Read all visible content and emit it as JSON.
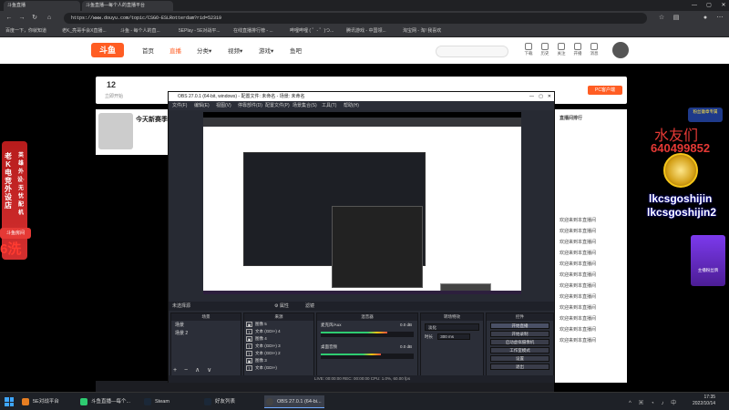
{
  "browser": {
    "tabs": [
      {
        "label": "斗鱼直播"
      },
      {
        "label": "斗鱼直播—每个人的直播平台"
      }
    ],
    "url": "https://www.douyu.com/topic/CSGO-ESLRotterdam?rid=52319",
    "bookmarks": [
      "百度一下，你就知道",
      "老K_亮哥手会X直播...",
      "斗鱼 - 每个人的直...",
      "5EPlay - 5E对战平...",
      "在线直播排行榜 - ...",
      "哔哩哔哩 ( ゜- ゜)つ...",
      "腾讯游戏 - 中国领...",
      "淘宝网 - 淘! 我喜欢"
    ]
  },
  "douyu": {
    "logo": "斗鱼",
    "nav": [
      "首页",
      "直播",
      "分类▾",
      "视频▾",
      "游戏▾",
      "鱼吧"
    ],
    "top_icons": [
      "下载",
      "历史",
      "关注",
      "开播",
      "消息"
    ],
    "top_panel": {
      "count": "12",
      "count_label": "立即开始",
      "pc_label": "PC客户端"
    },
    "streamer_title": "今天新赛季",
    "chat_lines": [
      "直播间排行",
      "欢迎来到本直播间",
      "欢迎来到本直播间",
      "欢迎来到本直播间",
      "欢迎来到本直播间",
      "欢迎来到本直播间",
      "欢迎来到本直播间",
      "欢迎来到本直播间",
      "欢迎来到本直播间",
      "欢迎来到本直播间",
      "欢迎来到本直播间",
      "欢迎来到本直播间",
      "欢迎来到本直播间"
    ]
  },
  "overlay": {
    "left_ad_text": "老K电竞外设店",
    "left_ad_vertical": "英雄外设·无忧配机",
    "left_badge": "斗鱼房间",
    "left_big": "6洗",
    "right_name": "水友们",
    "right_number": "640499852",
    "right_user1": "lkcsgoshijin",
    "right_user2": "lkcsgoshijin2",
    "right_banner": "粉丝徽章专属",
    "right_box": "主播粉丝牌"
  },
  "obs": {
    "title": "OBS 27.0.1 (64-bit, windows) - 配置文件: 未命名 - 场景: 未命名",
    "menu": [
      "文件(F)",
      "编辑(E)",
      "视图(V)",
      "停靠部件(D)",
      "配置文件(P)",
      "场景集合(S)",
      "工具(T)",
      "帮助(H)"
    ],
    "scene_strip": "未选择源",
    "scene_strip_props": "⚙ 属性",
    "scene_strip_filters": "滤镜",
    "docks": {
      "scenes": {
        "title": "场景",
        "items": [
          "场景",
          "场景 2"
        ]
      },
      "sources": {
        "title": "来源",
        "items": [
          {
            "label": "图像 5"
          },
          {
            "label": "文本 (GDI+) 4"
          },
          {
            "label": "图像 4"
          },
          {
            "label": "文本 (GDI+) 3"
          },
          {
            "label": "文本 (GDI+) 2"
          },
          {
            "label": "图像 3"
          },
          {
            "label": "文本 (GDI+)"
          }
        ]
      },
      "mixer": {
        "title": "混音器",
        "tracks": [
          {
            "name": "麦克风/Aux",
            "db": "0.0 dB",
            "level": 0.72
          },
          {
            "name": "桌面音频",
            "db": "0.0 dB",
            "level": 0.65
          }
        ]
      },
      "transitions": {
        "title": "转场特效",
        "type": "淡化",
        "duration_label": "时长",
        "duration": "300 ms"
      },
      "controls": {
        "title": "控件",
        "buttons": [
          "开始直播",
          "开始录制",
          "启动虚拟摄像机",
          "工作室模式",
          "设置",
          "退出"
        ]
      }
    },
    "status": "LIVE: 00:00:00   REC: 00:00:00   CPU: 1.0%, 60.00 fps"
  },
  "taskbar": {
    "items": [
      {
        "label": "5E对战平台"
      },
      {
        "label": "斗鱼直播—每个..."
      },
      {
        "label": "Steam"
      },
      {
        "label": "好友列表"
      },
      {
        "label": "OBS 27.0.1 (64-bi..."
      }
    ],
    "time": "17:35",
    "date": "2022/10/14"
  }
}
